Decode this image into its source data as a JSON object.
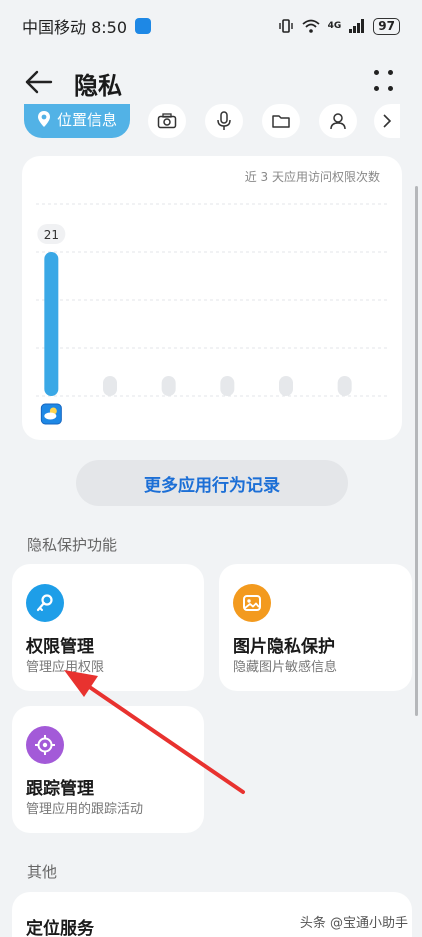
{
  "status_bar": {
    "carrier_time": "中国移动 8:50",
    "network": "4G",
    "battery": "97"
  },
  "header": {
    "title": "隐私"
  },
  "filters": {
    "active_label": "位置信息",
    "icons": [
      "camera-icon",
      "microphone-icon",
      "folder-icon",
      "contacts-icon",
      "chevron-right-icon"
    ]
  },
  "chart_data": {
    "type": "bar",
    "title": "近 3 天应用访问权限次数",
    "values": [
      21,
      0,
      0,
      0,
      0,
      0
    ],
    "data_labels": [
      "21"
    ],
    "ylim": [
      0,
      28
    ],
    "grid": true,
    "active_color": "#3aa8e6",
    "empty_color": "#e6e8eb"
  },
  "more_records_label": "更多应用行为记录",
  "privacy_section": {
    "label": "隐私保护功能",
    "cards": [
      {
        "title": "权限管理",
        "subtitle": "管理应用权限",
        "color": "#1e9ee8",
        "icon": "key-icon"
      },
      {
        "title": "图片隐私保护",
        "subtitle": "隐藏图片敏感信息",
        "color": "#f39a1e",
        "icon": "image-icon"
      },
      {
        "title": "跟踪管理",
        "subtitle": "管理应用的跟踪活动",
        "color": "#a35ad8",
        "icon": "target-icon"
      }
    ]
  },
  "other_section": {
    "label": "其他",
    "location_title": "定位服务"
  },
  "watermark": "头条 @宝通小助手",
  "annotation_color": "#e8322f"
}
